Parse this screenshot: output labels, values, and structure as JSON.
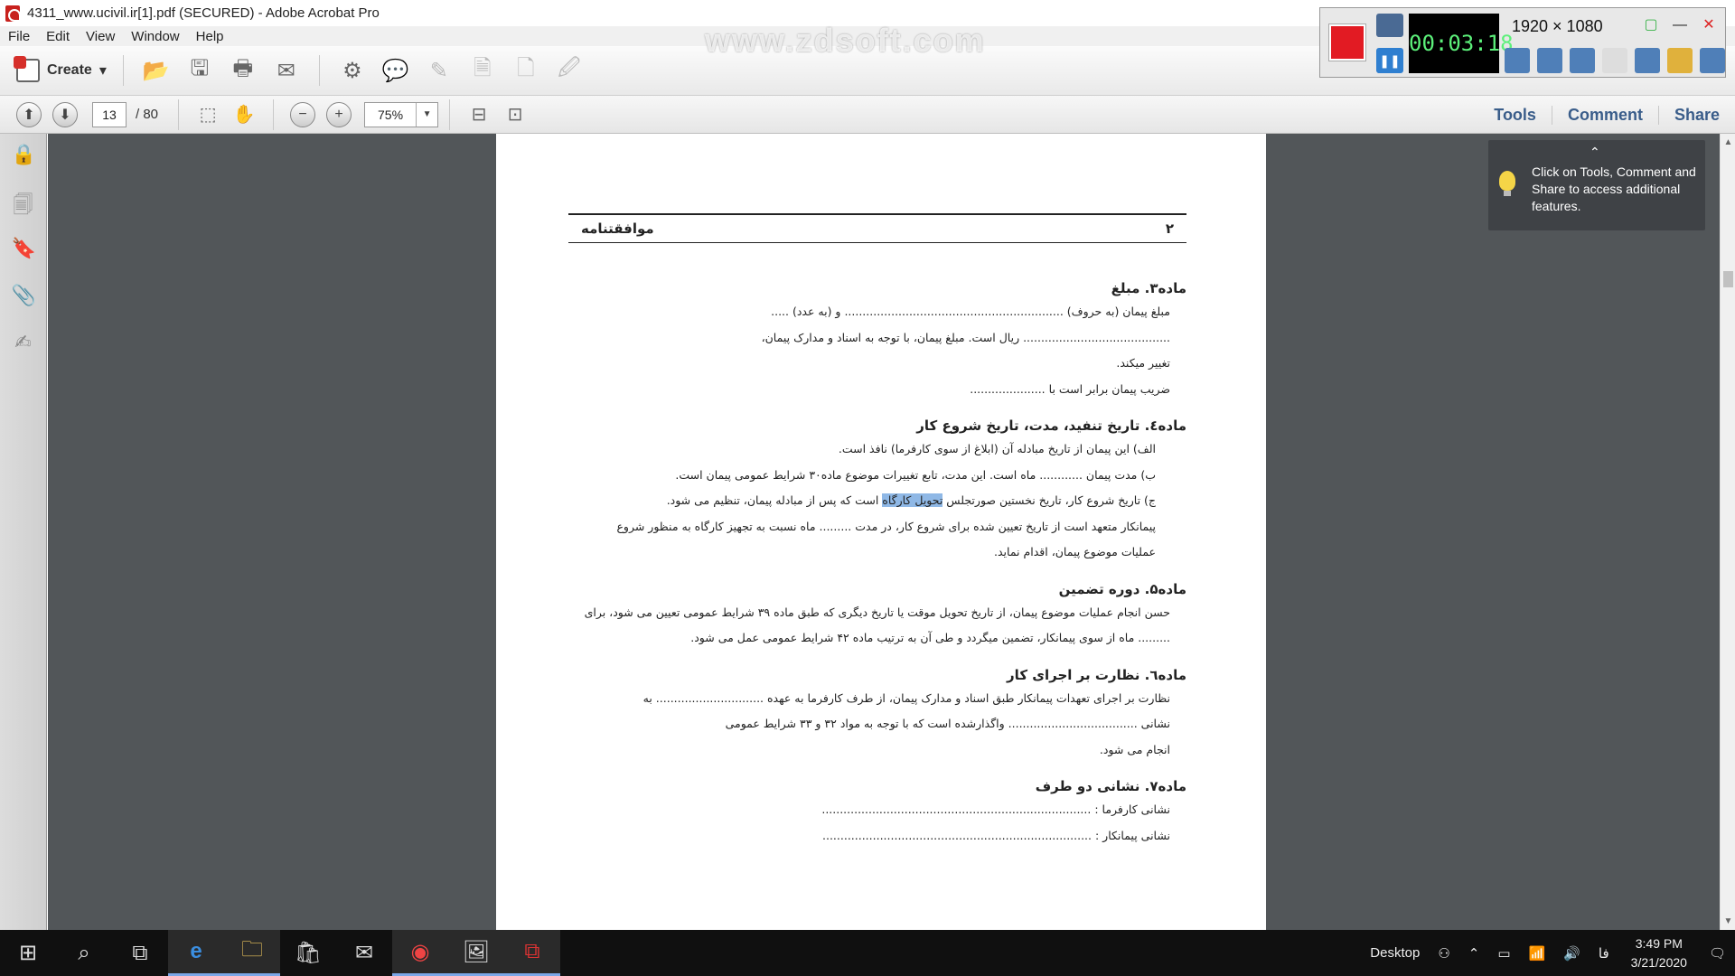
{
  "window": {
    "title": "4311_www.ucivil.ir[1].pdf (SECURED) - Adobe Acrobat Pro"
  },
  "menu": [
    "File",
    "Edit",
    "View",
    "Window",
    "Help"
  ],
  "toolbar": {
    "create_label": "Create"
  },
  "nav": {
    "page_current": "13",
    "page_total": "/ 80",
    "zoom": "75%"
  },
  "panel_links": {
    "tools": "Tools",
    "comment": "Comment",
    "share": "Share"
  },
  "tooltip": "Click on Tools, Comment and Share to access additional features.",
  "watermark": "www.zdsoft.com",
  "recorder": {
    "timer": "00:03:18",
    "resolution": "1920 × 1080"
  },
  "document": {
    "header_right": "موافقتنامه",
    "header_page": "۲",
    "lines": [
      {
        "cls": "h",
        "text": "ماده۳. مبلغ"
      },
      {
        "cls": "l ind",
        "text": "مبلغ پیمان (به حروف) ............................................................. و (به عدد) ....."
      },
      {
        "cls": "l ind",
        "text": "......................................... ریال است. مبلغ پیمان، با توجه به اسناد و مدارک پیمان،"
      },
      {
        "cls": "l ind",
        "text": "تغییر میکند."
      },
      {
        "cls": "l ind",
        "text": "ضریب پیمان برابر است با ....................."
      },
      {
        "cls": "h",
        "text": "ماده٤. تاریخ تنفید، مدت، تاریخ شروع کار"
      },
      {
        "cls": "l ind2",
        "text": "الف) این پیمان از تاریخ مبادله آن (ابلاغ از سوی کارفرما) نافذ است."
      },
      {
        "cls": "l ind2",
        "text": "ب) مدت پیمان ............ ماه است. این مدت، تابع تغییرات موضوع ماده۳۰ شرایط عمومی پیمان است."
      },
      {
        "cls": "l ind2",
        "hl": true,
        "pre": "ج) تاریخ شروع کار، تاریخ نخستین صورتجلس ",
        "mark": "تحویل کارگاه",
        "post": " است که پس از مبادله پیمان، تنظیم می شود."
      },
      {
        "cls": "l ind2",
        "text": "پیمانکار متعهد است از تاریخ تعیین شده برای شروع کار، در مدت ......... ماه نسبت به تجهیز کارگاه به منظور شروع"
      },
      {
        "cls": "l ind2",
        "text": "عملیات موضوع پیمان، اقدام نماید."
      },
      {
        "cls": "h",
        "text": "ماده۵. دوره تضمین"
      },
      {
        "cls": "l ind",
        "text": "حسن انجام عملیات موضوع پیمان، از تاریخ تحویل موقت یا تاریخ دیگری که طبق ماده ۳۹ شرایط عمومی تعیین می شود، برای"
      },
      {
        "cls": "l ind",
        "text": "......... ماه از سوی پیمانکار، تضمین میگردد و طی آن به ترتیب ماده ۴۲ شرایط عمومی عمل می شود."
      },
      {
        "cls": "h",
        "text": "ماده٦. نظارت بر اجرای کار"
      },
      {
        "cls": "l ind",
        "text": "نظارت بر اجرای تعهدات پیمانکار طبق اسناد و مدارک پیمان، از طرف کارفرما به عهده .............................. به"
      },
      {
        "cls": "l ind",
        "text": "نشانی .................................... واگذارشده است که با توجه به مواد ۳۲ و ۳۳ شرایط عمومی"
      },
      {
        "cls": "l ind",
        "text": "انجام می شود."
      },
      {
        "cls": "h",
        "text": "ماده۷. نشانی دو طرف"
      },
      {
        "cls": "l ind",
        "text": "نشانی کارفرما : ..........................................................................."
      },
      {
        "cls": "l ind",
        "text": "نشانی پیمانکار : ..........................................................................."
      }
    ]
  },
  "taskbar": {
    "desktop_label": "Desktop",
    "lang": "فا",
    "time": "3:49 PM",
    "date": "3/21/2020"
  }
}
